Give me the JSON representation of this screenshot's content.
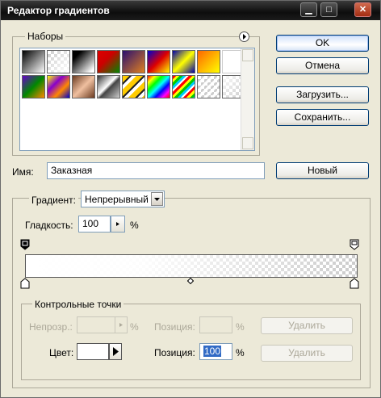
{
  "window": {
    "title": "Редактор градиентов"
  },
  "presets": {
    "label": "Наборы",
    "swatches": [
      "black-white",
      "transparent-white",
      "black-transparent",
      "red-green",
      "violet-orange",
      "blue-red-yellow",
      "blue-yellow-blue",
      "orange-yellow",
      "violet-green-orange",
      "yellow-violet-orange-blue",
      "copper",
      "chrome",
      "stripes-yellow",
      "spectrum",
      "transparent-rainbow",
      "transparent-stripes",
      "checker-transparent"
    ]
  },
  "buttons": {
    "ok": "OK",
    "cancel": "Отмена",
    "load": "Загрузить...",
    "save": "Сохранить...",
    "new": "Новый"
  },
  "name": {
    "label": "Имя:",
    "value": "Заказная"
  },
  "gradient": {
    "type_label": "Градиент:",
    "type_value": "Непрерывный",
    "smoothness_label": "Гладкость:",
    "smoothness_value": "100",
    "smoothness_unit": "%"
  },
  "stops": {
    "legend": "Контрольные точки",
    "opacity_label": "Непрозр.:",
    "opacity_unit": "%",
    "opacity_position_label": "Позиция:",
    "opacity_position_unit": "%",
    "opacity_delete": "Удалить",
    "color_label": "Цвет:",
    "color_value": "#ffffff",
    "color_position_label": "Позиция:",
    "color_position_value": "100",
    "color_position_unit": "%",
    "color_delete": "Удалить"
  }
}
